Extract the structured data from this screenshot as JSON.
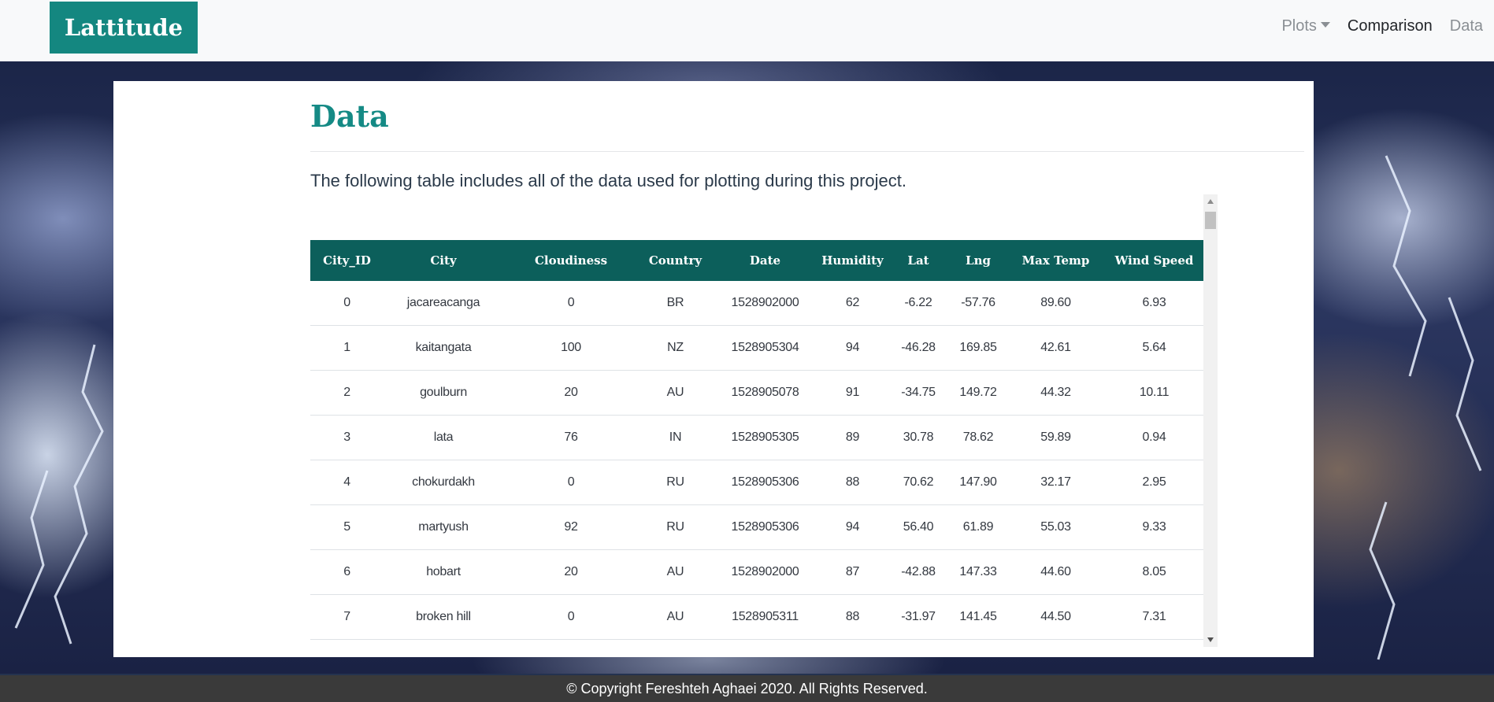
{
  "navbar": {
    "brand": "Lattitude",
    "links": [
      {
        "label": "Plots",
        "dropdown": true
      },
      {
        "label": "Comparison",
        "active": true
      },
      {
        "label": "Data"
      }
    ]
  },
  "main": {
    "title": "Data",
    "intro": "The following table includes all of the data used for plotting during this project."
  },
  "table": {
    "columns": [
      "City_ID",
      "City",
      "Cloudiness",
      "Country",
      "Date",
      "Humidity",
      "Lat",
      "Lng",
      "Max Temp",
      "Wind Speed"
    ],
    "rows": [
      [
        "0",
        "jacareacanga",
        "0",
        "BR",
        "1528902000",
        "62",
        "-6.22",
        "-57.76",
        "89.60",
        "6.93"
      ],
      [
        "1",
        "kaitangata",
        "100",
        "NZ",
        "1528905304",
        "94",
        "-46.28",
        "169.85",
        "42.61",
        "5.64"
      ],
      [
        "2",
        "goulburn",
        "20",
        "AU",
        "1528905078",
        "91",
        "-34.75",
        "149.72",
        "44.32",
        "10.11"
      ],
      [
        "3",
        "lata",
        "76",
        "IN",
        "1528905305",
        "89",
        "30.78",
        "78.62",
        "59.89",
        "0.94"
      ],
      [
        "4",
        "chokurdakh",
        "0",
        "RU",
        "1528905306",
        "88",
        "70.62",
        "147.90",
        "32.17",
        "2.95"
      ],
      [
        "5",
        "martyush",
        "92",
        "RU",
        "1528905306",
        "94",
        "56.40",
        "61.89",
        "55.03",
        "9.33"
      ],
      [
        "6",
        "hobart",
        "20",
        "AU",
        "1528902000",
        "87",
        "-42.88",
        "147.33",
        "44.60",
        "8.05"
      ],
      [
        "7",
        "broken hill",
        "0",
        "AU",
        "1528905311",
        "88",
        "-31.97",
        "141.45",
        "44.50",
        "7.31"
      ]
    ]
  },
  "footer": {
    "text": "© Copyright Fereshteh Aghaei 2020. All Rights Reserved."
  },
  "colors": {
    "brand": "#148780",
    "table_header": "#0c5f5b",
    "title": "#158a85"
  }
}
